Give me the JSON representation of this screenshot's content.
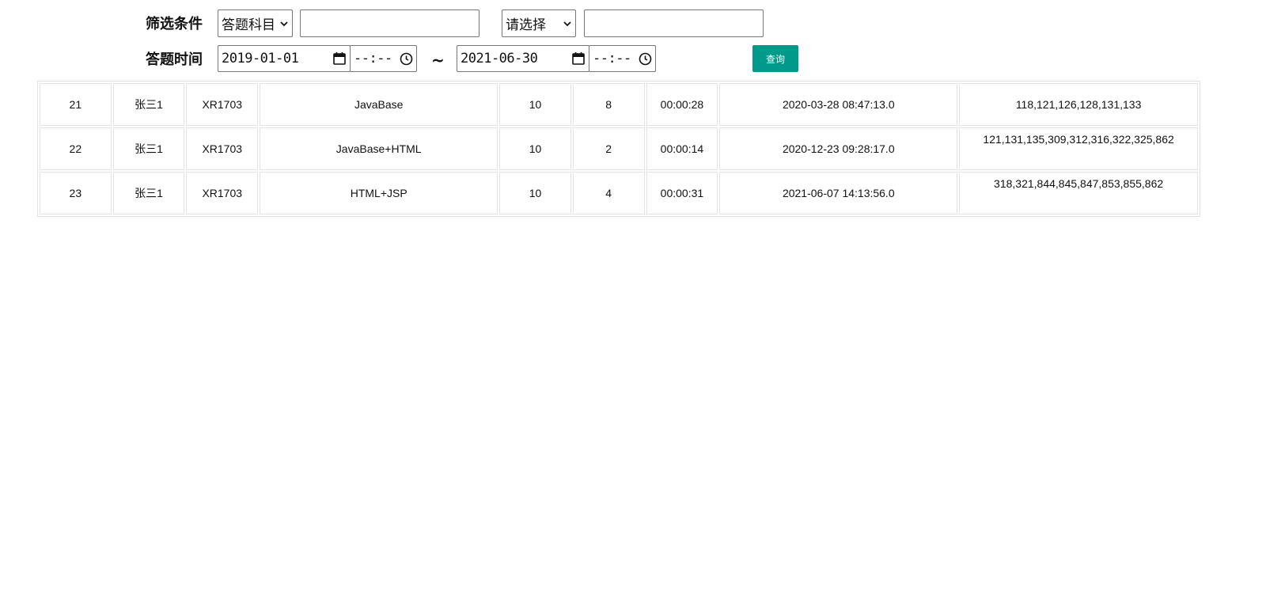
{
  "filters": {
    "condition_label": "筛选条件",
    "subject_select_value": "答题科目",
    "subject_input_value": "",
    "choose_select_value": "请选择",
    "choose_input_value": "",
    "time_label": "答题时间",
    "start_date": "2019-01-01",
    "start_time": "--:--",
    "range_separator": "~",
    "end_date": "2021-06-30",
    "end_time": "--:--",
    "query_button": "查询"
  },
  "colors": {
    "accent": "#009a8a",
    "border": "#e2e2e2"
  },
  "table": {
    "rows": [
      [
        "21",
        "张三1",
        "XR1703",
        "JavaBase",
        "10",
        "8",
        "00:00:28",
        "2020-03-28 08:47:13.0",
        "118,121,126,128,131,133"
      ],
      [
        "22",
        "张三1",
        "XR1703",
        "JavaBase+HTML",
        "10",
        "2",
        "00:00:14",
        "2020-12-23 09:28:17.0",
        "121,131,135,309,312,316,322,325,862"
      ],
      [
        "23",
        "张三1",
        "XR1703",
        "HTML+JSP",
        "10",
        "4",
        "00:00:31",
        "2021-06-07 14:13:56.0",
        "318,321,844,845,847,853,855,862"
      ]
    ]
  }
}
